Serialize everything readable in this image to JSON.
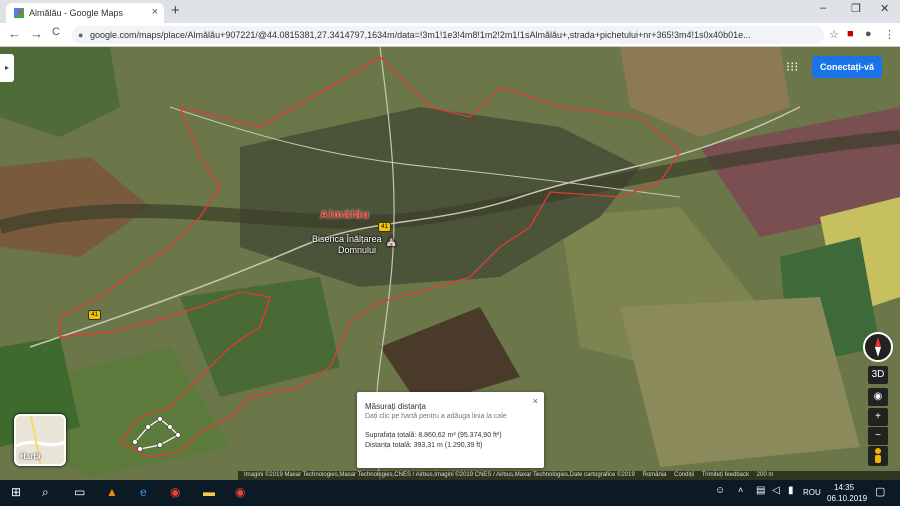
{
  "browser": {
    "tab_title": "Almălău - Google Maps",
    "tab_close": "×",
    "new_tab": "+",
    "window_controls": [
      "–",
      "❐",
      "✕"
    ],
    "url": "google.com/maps/place/Almălău+907221/@44.0815381,27.3414797,1634m/data=!3m1!1e3!4m8!1m2!2m1!1sAlmălău+,strada+pichetului+nr+365!3m4!1s0x40b01e...",
    "nav": [
      "←",
      "→",
      "C"
    ]
  },
  "map": {
    "town_label": "Almălău",
    "poi_label_line1": "Biserica Înălțarea",
    "poi_label_line2": "Domnului",
    "road_number_a": "41",
    "road_number_b": "41",
    "sidebar_toggle": "▸",
    "apps_icon": "⋮⋮⋮",
    "sign_in_label": "Conectați-vă",
    "map_type_label": "Hartă",
    "ctrl_3d": "3D",
    "ctrl_location": "◉",
    "ctrl_zoom_in": "+",
    "ctrl_zoom_out": "−",
    "colors": {
      "boundary": "#e53935",
      "accent": "#1a73e8"
    }
  },
  "measure_panel": {
    "title": "Măsurați distanța",
    "hint": "Dați clic pe hartă pentru a adăuga linia la cale",
    "area": "Suprafața totală: 8.860,62 m² (95.374,90 ft²)",
    "distance": "Distanța totală: 393,31 m (1.290,39 ft)",
    "close": "×"
  },
  "footer": {
    "imagery": "Imagini ©2019 Maxar Technologies,Maxar Technologies,CNES / Airbus,Imagini ©2019 CNES / Airbus,Maxar Technologies,Date cartografice ©2019",
    "country": "România",
    "terms": "Condiții",
    "feedback": "Trimiteți feedback",
    "scale": "200 m"
  },
  "taskbar": {
    "language": "ROU",
    "time": "14:35",
    "date": "06.10.2019"
  }
}
